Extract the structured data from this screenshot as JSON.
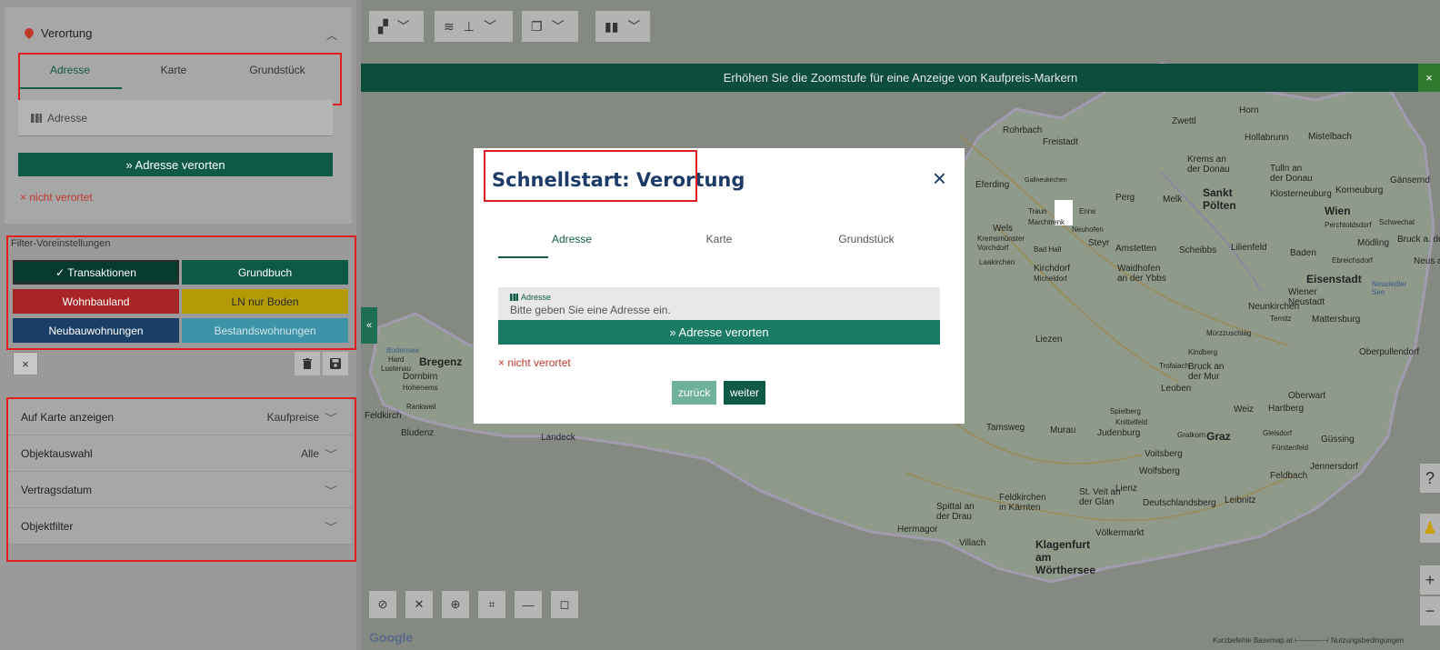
{
  "sidebar": {
    "section_title": "Verortung",
    "tabs": [
      {
        "label": "Adresse",
        "active": true
      },
      {
        "label": "Karte",
        "active": false
      },
      {
        "label": "Grundstück",
        "active": false
      }
    ],
    "address_placeholder": "Adresse",
    "locate_button": "» Adresse verorten",
    "status": "× nicht verortet",
    "filter_legend": "Filter-Voreinstellungen",
    "chips": {
      "transaktionen": "✓ Transaktionen",
      "grundbuch": "Grundbuch",
      "wohnbauland": "Wohnbauland",
      "ln_nur_boden": "LN nur Boden",
      "neubauwohnungen": "Neubauwohnungen",
      "bestandswohnungen": "Bestandswohnungen"
    },
    "clear_icon": "×",
    "options": [
      {
        "label": "Auf Karte anzeigen",
        "value": "Kaufpreise"
      },
      {
        "label": "Objektauswahl",
        "value": "Alle"
      },
      {
        "label": "Vertragsdatum",
        "value": ""
      },
      {
        "label": "Objektfilter",
        "value": ""
      }
    ]
  },
  "map": {
    "banner": "Erhöhen Sie die Zoomstufe für eine Anzeige von Kaufpreis-Markern",
    "banner_close": "×",
    "google": "Google",
    "attribution": "Kurzbefehle   Basemap.at   ⊢―――⊣   Nutzungsbedingungen",
    "help": "?",
    "zoom_in": "+",
    "zoom_out": "−",
    "collapse": "«",
    "labels": {
      "horn": "Horn",
      "zwettl": "Zwettl",
      "hollabrunn": "Hollabrunn",
      "mistelbach": "Mistelbach",
      "rohrbach": "Rohrbach",
      "freistadt": "Freistadt",
      "krems": "Krems an der Donau",
      "tulln": "Tulln an der Donau",
      "gaenserndorf": "Gänsernd",
      "eferding": "Eferding",
      "perg": "Perg",
      "melk": "Melk",
      "sankt_poelten": "Sankt Pölten",
      "klosterneuburg": "Klosterneuburg",
      "korneuburg": "Korneuburg",
      "wien": "Wien",
      "wels": "Wels",
      "steyr": "Steyr",
      "amstetten": "Amstetten",
      "scheibbs": "Scheibbs",
      "lilienfeld": "Lilienfeld",
      "baden": "Baden",
      "moedling": "Mödling",
      "kirchdorf": "Kirchdorf",
      "waidhofen": "Waidhofen an der Ybbs",
      "eisenstadt": "Eisenstadt",
      "wiener_neustadt": "Wiener Neustadt",
      "neunkirchen": "Neunkirchen",
      "mattersburg": "Mattersburg",
      "liezen": "Liezen",
      "oberpullendorf": "Oberpullendorf",
      "bregenz": "Bregenz",
      "dornbirn": "Dornbirn",
      "feldkirch": "Feldkirch",
      "bludenz": "Bludenz",
      "landeck": "Landeck",
      "bruck": "Bruck an der Mur",
      "leoben": "Leoben",
      "oberwart": "Oberwart",
      "weiz": "Weiz",
      "hartberg": "Hartberg",
      "tamsweg": "Tamsweg",
      "murau": "Murau",
      "judenburg": "Judenburg",
      "graz": "Graz",
      "voitsberg": "Voitsberg",
      "guessing": "Güssing",
      "jennersdorf": "Jennersdorf",
      "feldbach": "Feldbach",
      "lienz": "Lienz",
      "spittal": "Spittal an der Drau",
      "feldkirchen": "Feldkirchen in Kärnten",
      "st_veit": "St. Veit an der Glan",
      "wolfsberg": "Wolfsberg",
      "deutschlandsberg": "Deutschlandsberg",
      "leibnitz": "Leibnitz",
      "hermagor": "Hermagor",
      "villach": "Villach",
      "klagenfurt": "Klagenfurt am Wörthersee",
      "voelkermarkt": "Völkermarkt",
      "bodensee": "Bodensee",
      "neusiedler": "Neusiedler See",
      "traun": "Traun",
      "marchtrenk": "Marchtrenk",
      "gallneukirchen": "Gallneukirchen",
      "bad_hall": "Bad Hall",
      "laakirchen": "Laakirchen",
      "micheldorf": "Micheldorf",
      "vorchdorf": "Vorchdorf",
      "kremsmuenster": "Kremsmünster",
      "enns": "Enns",
      "neuhofen": "Neuhofen",
      "perchtoldsdorf": "Perchtoldsdorf",
      "schwechat": "Schwechat",
      "ebreichsdorf": "Ebreichsdorf",
      "ternitz": "Ternitz",
      "muerzzuschlag": "Mürzzuschlag",
      "kindberg": "Kindberg",
      "trofaiach": "Trofaiach",
      "spielberg": "Spielberg",
      "knittelfeld": "Knittelfeld",
      "gratkorn": "Gratkorn",
      "gleisdorf": "Gleisdorf",
      "fuerstenfeld": "Fürstenfeld",
      "hard": "Hard",
      "lustenau": "Lustenau",
      "hohenems": "Hohenems",
      "rankweil": "Rankweil",
      "bruck_leitha": "Bruck a. der Lei",
      "neus_am": "Neus am S"
    }
  },
  "modal": {
    "title": "Schnellstart: Verortung",
    "close": "×",
    "tabs": [
      {
        "label": "Adresse",
        "active": true
      },
      {
        "label": "Karte",
        "active": false
      },
      {
        "label": "Grundstück",
        "active": false
      }
    ],
    "address_label": "Adresse",
    "address_placeholder": "Bitte geben Sie eine Adresse ein.",
    "locate_button": "» Adresse verorten",
    "status": "× nicht verortet",
    "back": "zurück",
    "next": "weiter"
  },
  "colors": {
    "primary_green": "#0e5a47",
    "error_red": "#c0392b",
    "title_blue": "#1c3b66",
    "annotation_red": "#e02020"
  }
}
